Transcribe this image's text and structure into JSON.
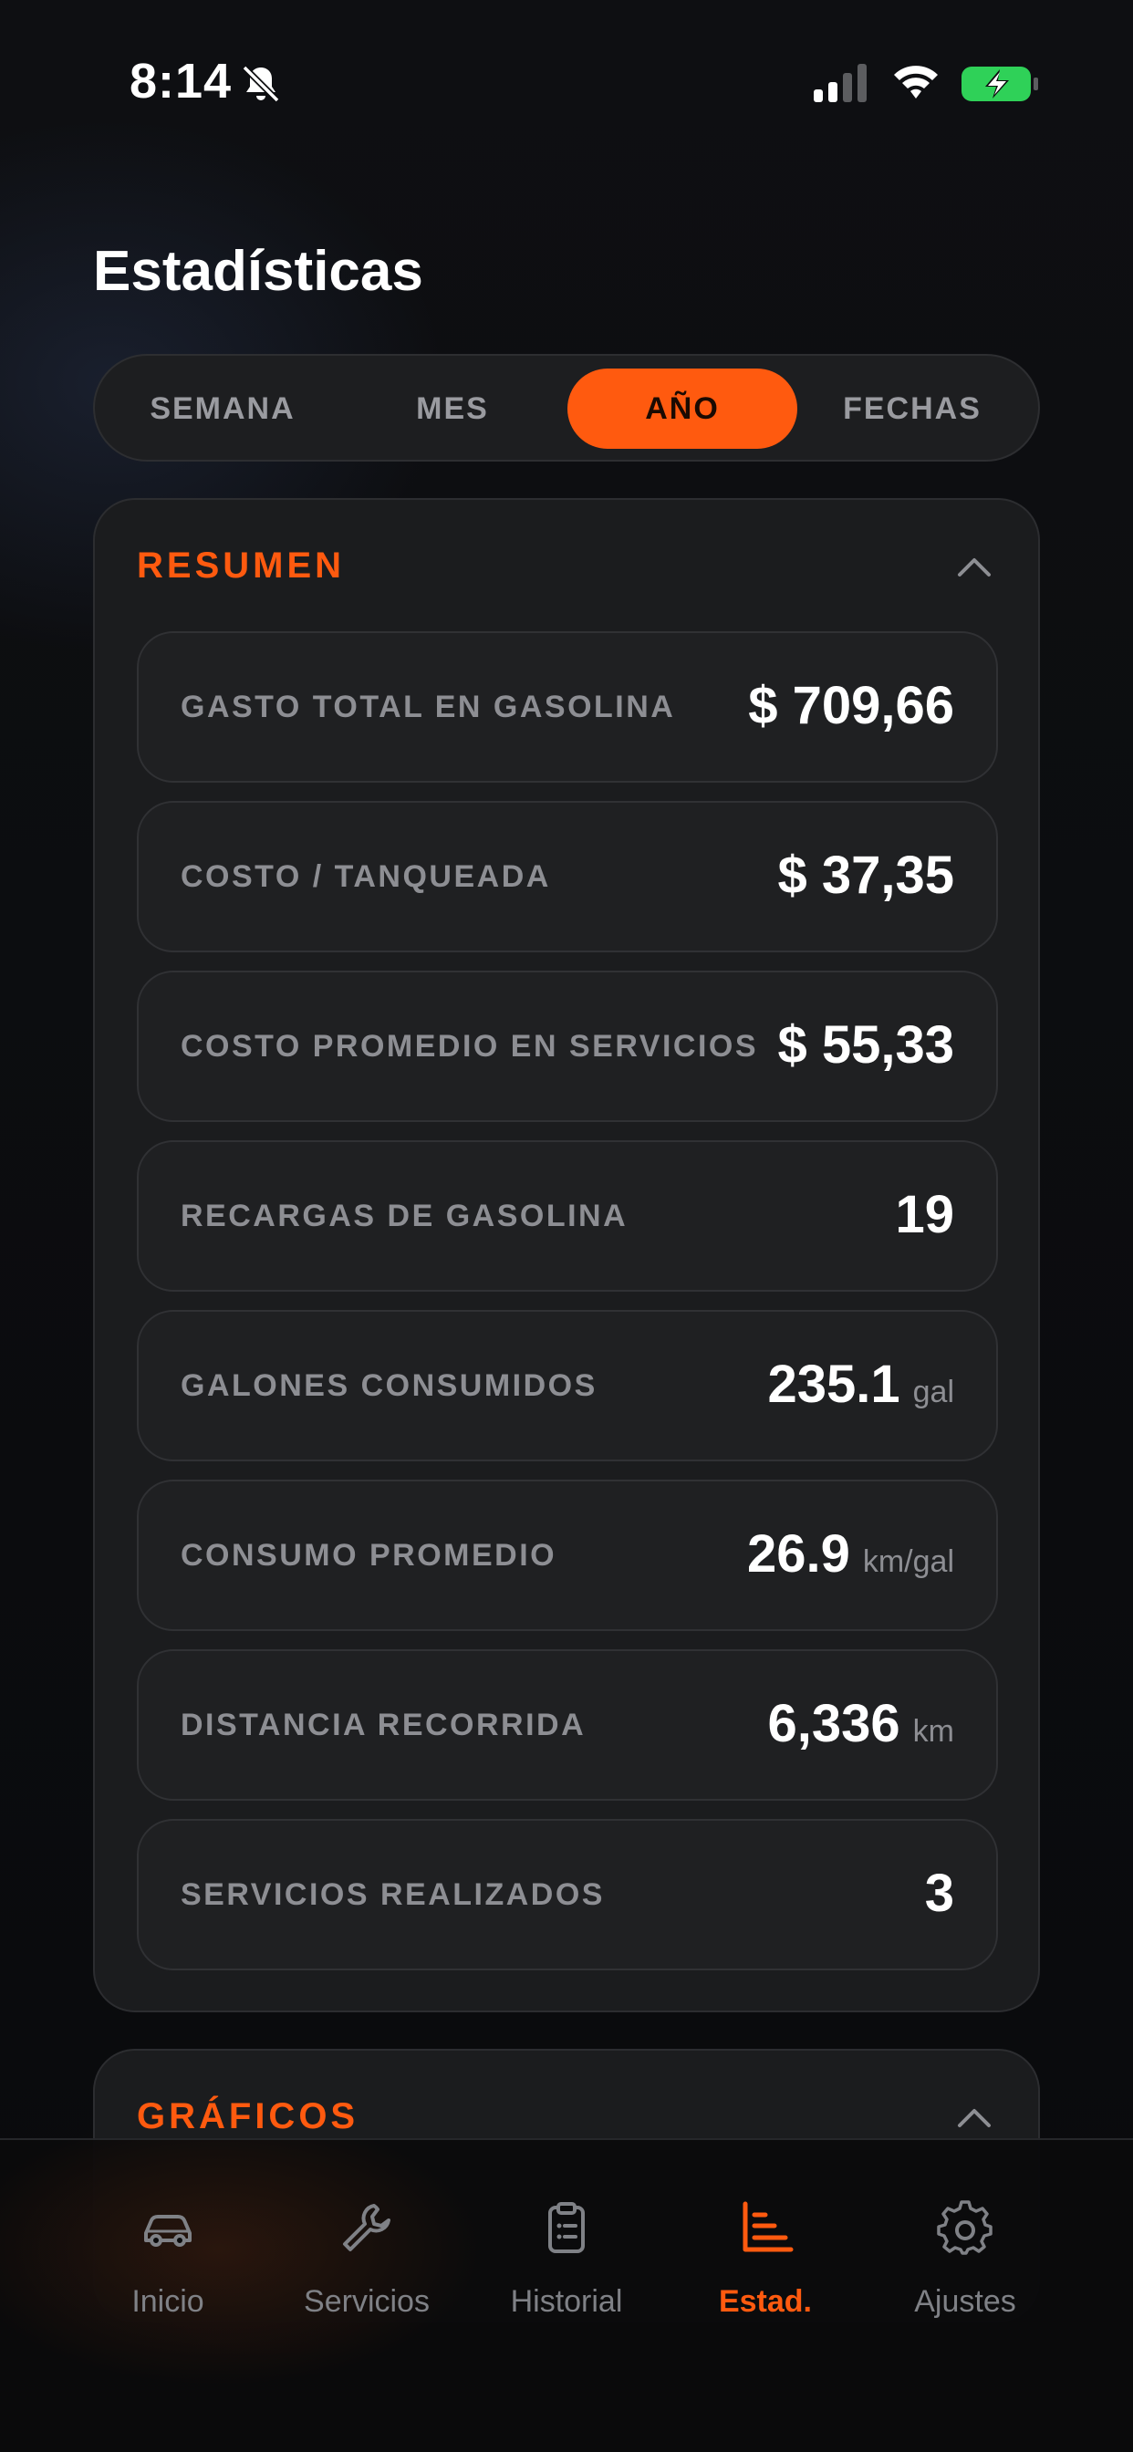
{
  "status_bar": {
    "time": "8:14"
  },
  "page": {
    "title": "Estadísticas"
  },
  "period_tabs": [
    {
      "label": "SEMANA",
      "active": false
    },
    {
      "label": "MES",
      "active": false
    },
    {
      "label": "AÑO",
      "active": true
    },
    {
      "label": "FECHAS",
      "active": false
    }
  ],
  "resumen": {
    "title": "RESUMEN",
    "rows": [
      {
        "label": "GASTO TOTAL EN GASOLINA",
        "value": "$ 709,66",
        "unit": ""
      },
      {
        "label": "COSTO / TANQUEADA",
        "value": "$ 37,35",
        "unit": ""
      },
      {
        "label": "COSTO PROMEDIO EN SERVICIOS",
        "value": "$ 55,33",
        "unit": ""
      },
      {
        "label": "RECARGAS DE GASOLINA",
        "value": "19",
        "unit": ""
      },
      {
        "label": "GALONES CONSUMIDOS",
        "value": "235.1",
        "unit": "gal"
      },
      {
        "label": "CONSUMO PROMEDIO",
        "value": "26.9",
        "unit": "km/gal"
      },
      {
        "label": "DISTANCIA RECORRIDA",
        "value": "6,336",
        "unit": "km"
      },
      {
        "label": "SERVICIOS REALIZADOS",
        "value": "3",
        "unit": ""
      }
    ]
  },
  "graficos": {
    "title": "GRÁFICOS"
  },
  "tab_bar": {
    "items": [
      {
        "label": "Inicio",
        "icon": "car-icon",
        "active": false
      },
      {
        "label": "Servicios",
        "icon": "wrench-icon",
        "active": false
      },
      {
        "label": "Historial",
        "icon": "clipboard-icon",
        "active": false
      },
      {
        "label": "Estad.",
        "icon": "bar-chart-icon",
        "active": true
      },
      {
        "label": "Ajustes",
        "icon": "gear-icon",
        "active": false
      }
    ]
  },
  "colors": {
    "accent": "#ff5a0f",
    "background": "#0b0c0e",
    "card": "#1b1c1e",
    "muted_text": "#8d8e93"
  }
}
